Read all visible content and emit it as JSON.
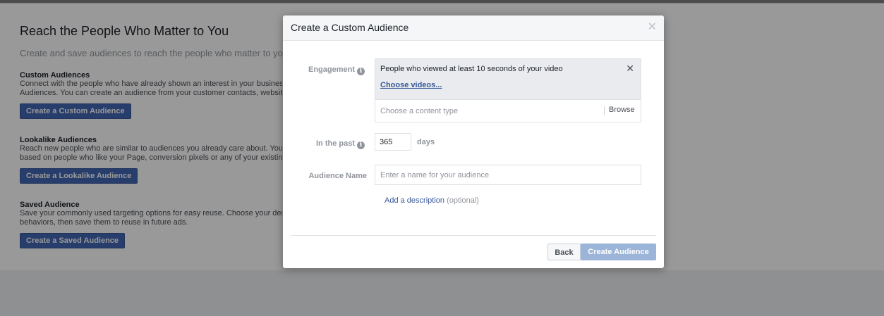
{
  "background_page": {
    "title": "Reach the People Who Matter to You",
    "subtitle": "Create and save audiences to reach the people who matter to your",
    "sections": [
      {
        "heading": "Custom Audiences",
        "lines": [
          "Connect with the people who have already shown an interest in your business",
          "Audiences. You can create an audience from your customer contacts, website"
        ],
        "button": "Create a Custom Audience"
      },
      {
        "heading": "Lookalike Audiences",
        "lines": [
          "Reach new people who are similar to audiences you already care about. You c",
          "based on people who like your Page, conversion pixels or any of your existing"
        ],
        "button": "Create a Lookalike Audience"
      },
      {
        "heading": "Saved Audience",
        "lines": [
          "Save your commonly used targeting options for easy reuse. Choose your dem",
          "behaviors, then save them to reuse in future ads."
        ],
        "button": "Create a Saved Audience"
      }
    ]
  },
  "modal": {
    "title": "Create a Custom Audience",
    "close_icon": "close-icon",
    "engagement": {
      "label": "Engagement",
      "rule": "People who viewed at least 10 seconds of your video",
      "choose_link": "Choose videos...",
      "content_type_placeholder": "Choose a content type",
      "browse": "Browse"
    },
    "in_the_past": {
      "label": "In the past",
      "value": "365",
      "unit": "days"
    },
    "audience_name": {
      "label": "Audience Name",
      "placeholder": "Enter a name for your audience",
      "value": ""
    },
    "description": {
      "link": "Add a description",
      "optional": "(optional)"
    },
    "footer": {
      "back": "Back",
      "create": "Create Audience"
    }
  },
  "colors": {
    "primary_button": "#4267b2",
    "disabled_button": "#9cb4d8",
    "link": "#365899"
  }
}
